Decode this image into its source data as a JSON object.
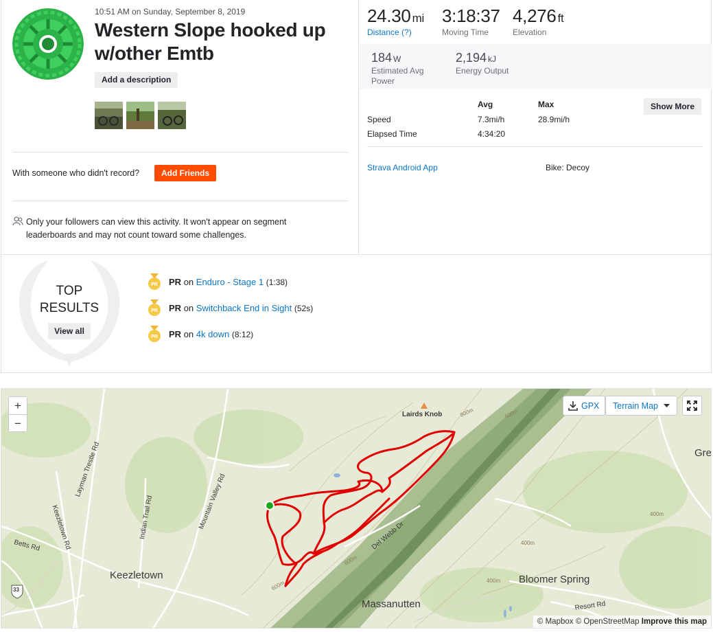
{
  "activity": {
    "datetime": "10:51 AM on Sunday, September 8, 2019",
    "title": "Western Slope hooked up w/other Emtb",
    "add_description_label": "Add a description",
    "photos": [
      "photo-1",
      "photo-2",
      "photo-3"
    ],
    "with_someone_text": "With someone who didn't record?",
    "add_friends_label": "Add Friends",
    "privacy_text": "Only your followers can view this activity. It won't appear on segment leaderboards and may not count toward some challenges."
  },
  "stats": {
    "distance": {
      "value": "24.30",
      "unit": "mi",
      "label": "Distance (?)"
    },
    "moving_time": {
      "value": "3:18:37",
      "label": "Moving Time"
    },
    "elevation": {
      "value": "4,276",
      "unit": "ft",
      "label": "Elevation"
    },
    "power": {
      "value": "184",
      "unit": "W",
      "label": "Estimated Avg Power"
    },
    "energy": {
      "value": "2,194",
      "unit": "kJ",
      "label": "Energy Output"
    }
  },
  "more_stats": {
    "avg_header": "Avg",
    "max_header": "Max",
    "show_more_label": "Show More",
    "rows": [
      {
        "label": "Speed",
        "avg": "7.3mi/h",
        "max": "28.9mi/h"
      },
      {
        "label": "Elapsed Time",
        "avg": "4:34:20",
        "max": ""
      }
    ],
    "device": "Strava Android App",
    "bike": "Bike: Decoy"
  },
  "top_results": {
    "title_line1": "TOP",
    "title_line2": "RESULTS",
    "view_all_label": "View all",
    "items": [
      {
        "badge": "PR",
        "prefix": "PR",
        "on": "on",
        "segment": "Enduro - Stage 1",
        "time": "(1:38)"
      },
      {
        "badge": "PR",
        "prefix": "PR",
        "on": "on",
        "segment": "Switchback End in Sight",
        "time": "(52s)"
      },
      {
        "badge": "PR",
        "prefix": "PR",
        "on": "on",
        "segment": "4k down",
        "time": "(8:12)"
      }
    ]
  },
  "map": {
    "zoom_in": "+",
    "zoom_out": "−",
    "gpx_label": "GPX",
    "terrain_label": "Terrain Map",
    "attribution_mapbox": "© Mapbox",
    "attribution_osm": "© OpenStreetMap",
    "attribution_improve": "Improve this map",
    "route_color": "#e00000",
    "start_color": "#1ea51e",
    "labels": {
      "lairds_knob": "Lairds Knob",
      "keezletown": "Keezletown",
      "massanutten": "Massanutten",
      "bloomer_spring": "Bloomer Spring",
      "gre": "Gre",
      "layman_trestle": "Layman Trestle Rd",
      "keezletown_rd": "Keezletown Rd",
      "indian_trail": "Indian Trail Rd",
      "mountain_valley": "Mountain Valley Rd",
      "betts": "Betts Rd",
      "del_webb": "Del Webb Dr",
      "resort_rd": "Resort Rd",
      "route_33": "33",
      "c800a": "800m",
      "c600a": "600m",
      "c600b": "600m",
      "c600c": "600m",
      "c400a": "400m",
      "c400b": "400m",
      "c400c": "400m"
    }
  }
}
